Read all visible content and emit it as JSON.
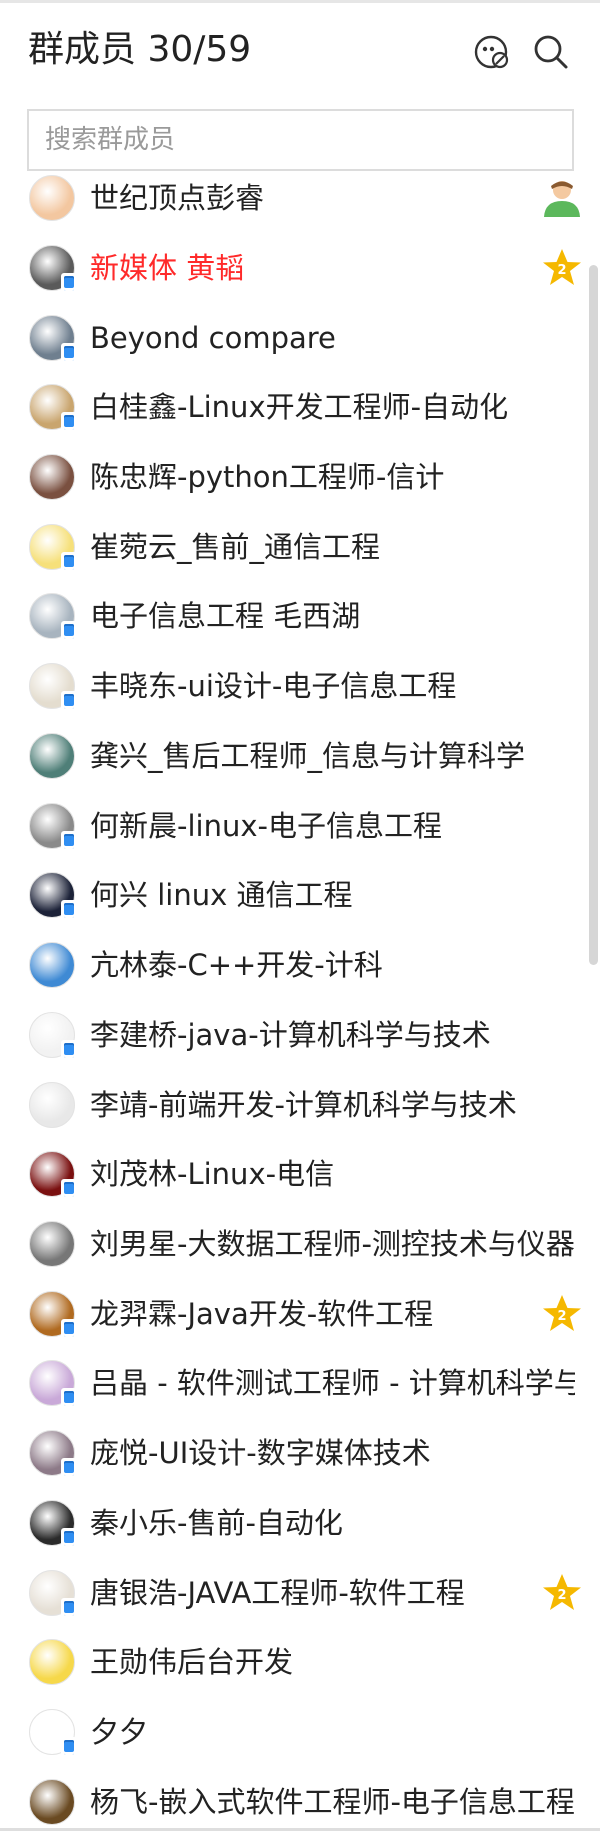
{
  "header": {
    "title": "群成员 30/59"
  },
  "search": {
    "placeholder": "搜索群成员"
  },
  "colors": {
    "admin_star": "#f5b800",
    "owner_icon": "#5cb85c",
    "highlight_name": "#ff2a2a",
    "mobile_badge": "#2f8ef2"
  },
  "members": [
    {
      "name": "世纪顶点彭睿",
      "avatar": "#f3c7a0",
      "mobile": false,
      "role": "owner"
    },
    {
      "name": "新媒体  黄韬",
      "avatar": "#5a5a5a",
      "mobile": true,
      "role": "admin",
      "highlight": true
    },
    {
      "name": "Beyond compare",
      "avatar": "#6f7f8f",
      "mobile": true,
      "role": ""
    },
    {
      "name": "白桂鑫-Linux开发工程师-自动化",
      "avatar": "#c9a56e",
      "mobile": true,
      "role": ""
    },
    {
      "name": "陈忠辉-python工程师-信计",
      "avatar": "#7a5040",
      "mobile": false,
      "role": ""
    },
    {
      "name": "崔菀云_售前_通信工程",
      "avatar": "#f6e07a",
      "mobile": true,
      "role": ""
    },
    {
      "name": "电子信息工程 毛西湖",
      "avatar": "#a8b4bf",
      "mobile": true,
      "role": ""
    },
    {
      "name": "丰晓东-ui设计-电子信息工程",
      "avatar": "#e4ddcf",
      "mobile": true,
      "role": ""
    },
    {
      "name": "龚兴_售后工程师_信息与计算科学",
      "avatar": "#4f7f78",
      "mobile": false,
      "role": ""
    },
    {
      "name": "何新晨-linux-电子信息工程",
      "avatar": "#8a8a8a",
      "mobile": true,
      "role": ""
    },
    {
      "name": "何兴 linux 通信工程",
      "avatar": "#1c2238",
      "mobile": true,
      "role": ""
    },
    {
      "name": "亢林泰-C++开发-计科",
      "avatar": "#3f8ad4",
      "mobile": false,
      "role": ""
    },
    {
      "name": "李建桥-java-计算机科学与技术",
      "avatar": "#f2f2f2",
      "mobile": true,
      "role": ""
    },
    {
      "name": "李靖-前端开发-计算机科学与技术",
      "avatar": "#e8e8e8",
      "mobile": false,
      "role": ""
    },
    {
      "name": "刘茂林-Linux-电信",
      "avatar": "#7a1010",
      "mobile": true,
      "role": ""
    },
    {
      "name": "刘男星-大数据工程师-测控技术与仪器",
      "avatar": "#777777",
      "mobile": false,
      "role": ""
    },
    {
      "name": "龙羿霖-Java开发-软件工程",
      "avatar": "#b06a20",
      "mobile": true,
      "role": "admin"
    },
    {
      "name": "吕晶 - 软件测试工程师 - 计算机科学与技术",
      "avatar": "#c9a9d8",
      "mobile": true,
      "role": ""
    },
    {
      "name": "庞悦-UI设计-数字媒体技术",
      "avatar": "#8d7a88",
      "mobile": true,
      "role": ""
    },
    {
      "name": "秦小乐-售前-自动化",
      "avatar": "#2b2b2b",
      "mobile": true,
      "role": ""
    },
    {
      "name": "唐银浩-JAVA工程师-软件工程",
      "avatar": "#e6e0d6",
      "mobile": true,
      "role": "admin"
    },
    {
      "name": "王勋伟后台开发",
      "avatar": "#f6d84a",
      "mobile": false,
      "role": ""
    },
    {
      "name": "夕夕",
      "avatar": "#ffffff",
      "mobile": true,
      "role": ""
    },
    {
      "name": "杨飞-嵌入式软件工程师-电子信息工程",
      "avatar": "#6a4a22",
      "mobile": false,
      "role": ""
    }
  ]
}
